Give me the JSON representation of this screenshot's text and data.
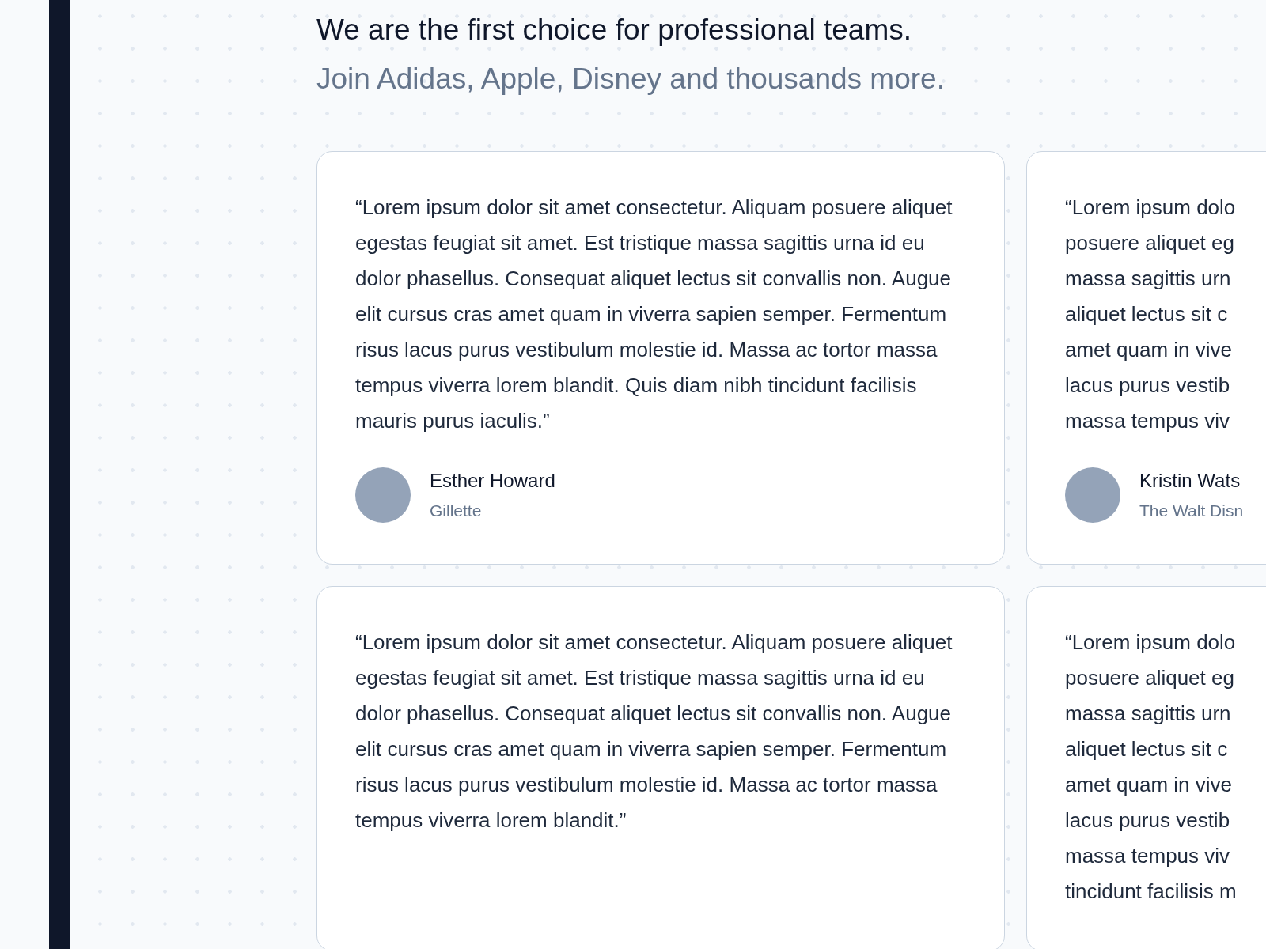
{
  "heading": "We are the first choice for professional teams.",
  "subheading": "Join Adidas, Apple, Disney and thousands more.",
  "rows": [
    {
      "cards": [
        {
          "quote": "“Lorem ipsum dolor sit amet consectetur. Aliquam posuere aliquet egestas feugiat sit amet. Est tristique massa sagittis urna id eu dolor phasellus. Consequat aliquet lectus sit convallis non. Augue elit cursus cras amet quam in viverra sapien semper. Fermentum risus lacus purus vestibulum molestie id. Massa ac tortor massa tempus viverra lorem blandit. Quis diam nibh tincidunt facilisis mauris purus iaculis.”",
          "author": {
            "name": "Esther Howard",
            "company": "Gillette"
          }
        },
        {
          "quote_lines": [
            "“Lorem ipsum dolo",
            "posuere aliquet eg",
            "massa sagittis urn",
            "aliquet lectus sit c",
            "amet quam in vive",
            "lacus purus vestib",
            "massa tempus viv"
          ],
          "author": {
            "name": "Kristin Wats",
            "company": "The Walt Disn"
          }
        }
      ]
    },
    {
      "cards": [
        {
          "quote": "“Lorem ipsum dolor sit amet consectetur. Aliquam posuere aliquet egestas feugiat sit amet. Est tristique massa sagittis urna id eu dolor phasellus. Consequat aliquet lectus sit convallis non. Augue elit cursus cras amet quam in viverra sapien semper. Fermentum risus lacus purus vestibulum molestie id. Massa ac tortor massa tempus viverra lorem blandit.”"
        },
        {
          "quote_lines": [
            "“Lorem ipsum dolo",
            "posuere aliquet eg",
            "massa sagittis urn",
            "aliquet lectus sit c",
            "amet quam in vive",
            "lacus purus vestib",
            "massa tempus viv",
            "tincidunt facilisis m"
          ]
        }
      ]
    }
  ]
}
